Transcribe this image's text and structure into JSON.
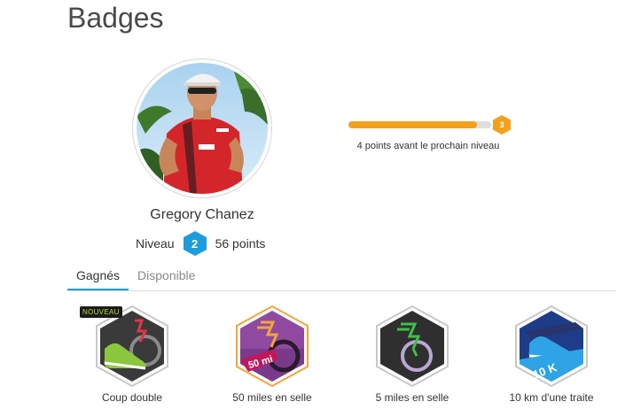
{
  "page": {
    "title": "Badges"
  },
  "profile": {
    "name": "Gregory Chanez",
    "level_label": "Niveau",
    "level": "2",
    "points_text": "56 points"
  },
  "progress": {
    "next_level": "3",
    "fraction": 0.9,
    "caption": "4 points avant le prochain niveau"
  },
  "tabs": [
    {
      "label": "Gagnés",
      "active": true
    },
    {
      "label": "Disponible",
      "active": false
    }
  ],
  "badges": [
    {
      "label": "Coup double",
      "tag": "NOUVEAU",
      "icon": "double-sneaker-icon"
    },
    {
      "label": "50 miles en selle",
      "badge_text": "50 mi",
      "icon": "bike-50mi-icon"
    },
    {
      "label": "5 miles en selle",
      "icon": "bike-5mi-icon"
    },
    {
      "label": "10 km d'une traite",
      "badge_text": "10 K",
      "icon": "running-10k-icon"
    }
  ],
  "colors": {
    "accent_blue": "#1e9cdb",
    "progress_orange": "#f5a01a",
    "new_tag_green": "#b6e02a"
  }
}
